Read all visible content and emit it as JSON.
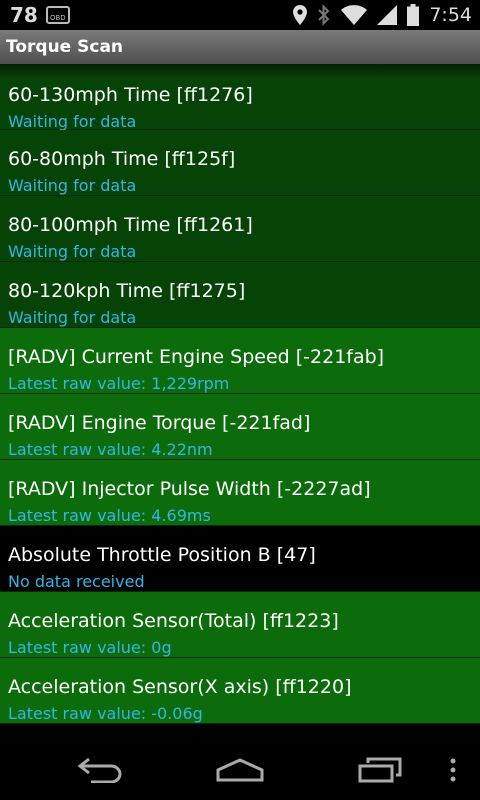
{
  "status_bar": {
    "notification_count": "78",
    "obd_label": "OBD",
    "time": "7:54"
  },
  "title": "Torque Scan",
  "items": [
    {
      "title": "60-130mph Time [ff1276]",
      "subtitle": "Waiting for data",
      "shade": "dark"
    },
    {
      "title": "60-80mph Time [ff125f]",
      "subtitle": "Waiting for data",
      "shade": "dark"
    },
    {
      "title": "80-100mph Time [ff1261]",
      "subtitle": "Waiting for data",
      "shade": "dark"
    },
    {
      "title": "80-120kph Time [ff1275]",
      "subtitle": "Waiting for data",
      "shade": "dark"
    },
    {
      "title": "[RADV] Current Engine Speed [-221fab]",
      "subtitle": "Latest raw value: 1,229rpm",
      "shade": "bright"
    },
    {
      "title": "[RADV] Engine Torque [-221fad]",
      "subtitle": "Latest raw value: 4.22nm",
      "shade": "bright"
    },
    {
      "title": "[RADV] Injector Pulse Width [-2227ad]",
      "subtitle": "Latest raw value: 4.69ms",
      "shade": "bright"
    },
    {
      "title": "Absolute Throttle Position B [47]",
      "subtitle": "No data received",
      "shade": "black"
    },
    {
      "title": "Acceleration Sensor(Total) [ff1223]",
      "subtitle": "Latest raw value: 0g",
      "shade": "bright"
    },
    {
      "title": "Acceleration Sensor(X axis) [ff1220]",
      "subtitle": "Latest raw value: -0.06g",
      "shade": "bright"
    }
  ],
  "icons": {
    "location": "location-icon",
    "bluetooth": "bluetooth-icon",
    "wifi": "wifi-icon",
    "signal": "signal-icon",
    "battery": "battery-icon",
    "back": "back-icon",
    "home": "home-icon",
    "recents": "recents-icon",
    "overflow": "overflow-menu-icon"
  },
  "colors": {
    "row_dark": "#064306",
    "row_bright": "#0c6c0c",
    "subtitle": "#33b5e5"
  }
}
